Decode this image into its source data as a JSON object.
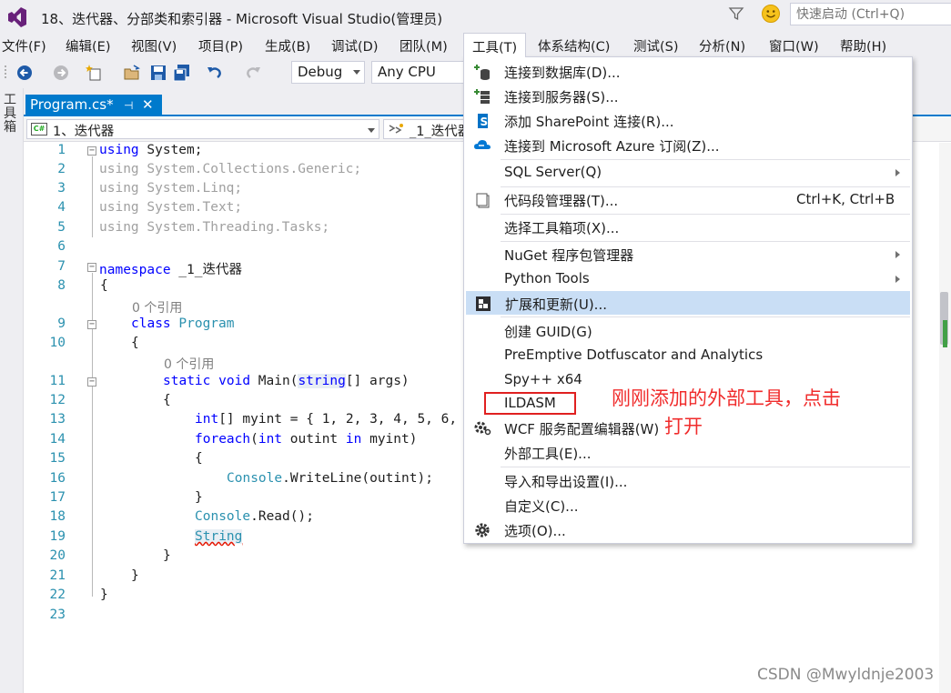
{
  "window": {
    "title": "18、迭代器、分部类和索引器 - Microsoft Visual Studio(管理员)",
    "quick_launch_placeholder": "快速启动 (Ctrl+Q)"
  },
  "menubar": {
    "items": [
      "文件(F)",
      "编辑(E)",
      "视图(V)",
      "项目(P)",
      "生成(B)",
      "调试(D)",
      "团队(M)",
      "工具(T)",
      "体系结构(C)",
      "测试(S)",
      "分析(N)",
      "窗口(W)",
      "帮助(H)"
    ],
    "open_item": "工具(T)"
  },
  "toolbar": {
    "config": "Debug",
    "platform": "Any CPU"
  },
  "toolbox_label": "工具箱",
  "tab": {
    "title": "Program.cs*",
    "pin_glyph": "⊣",
    "close_glyph": "✕"
  },
  "navbar": {
    "left": "1、迭代器",
    "right": "_1_迭代器"
  },
  "editor": {
    "line_numbers": [
      "1",
      "2",
      "3",
      "4",
      "5",
      "6",
      "7",
      "8",
      "9",
      "10",
      "11",
      "12",
      "13",
      "14",
      "15",
      "16",
      "17",
      "18",
      "19",
      "20",
      "21",
      "22",
      "23"
    ],
    "lines": {
      "l1_using": "using",
      "l1_rest": " System;",
      "l2": "using System.Collections.Generic;",
      "l3": "using System.Linq;",
      "l4": "using System.Text;",
      "l5": "using System.Threading.Tasks;",
      "l7_kw": "namespace",
      "l7_rest": " _1_迭代器",
      "l8": "{",
      "ref1": "0 个引用",
      "l9_kw": "class",
      "l9_type": "Program",
      "l10": "{",
      "ref2": "0 个引用",
      "l11_kw1": "static",
      "l11_kw2": "void",
      "l11_name": "Main(",
      "l11_type": "string",
      "l11_rest": "[] args)",
      "l12": "{",
      "l13_kw": "int",
      "l13_rest": "[] myint = { 1, 2, 3, 4, 5, 6,",
      "l14_kw": "foreach",
      "l14_p": "(",
      "l14_kw2": "int",
      "l14_mid": " outint ",
      "l14_kw3": "in",
      "l14_rest": " myint)",
      "l15": "{",
      "l16_type": "Console",
      "l16_rest": ".WriteLine(outint);",
      "l17": "}",
      "l18_type": "Console",
      "l18_rest": ".Read();",
      "l19_type": "String",
      "l20": "}",
      "l21": "}",
      "l22": "}"
    }
  },
  "tools_menu": {
    "items": [
      {
        "label": "连接到数据库(D)...",
        "icon": "database-plus-icon"
      },
      {
        "label": "连接到服务器(S)...",
        "icon": "server-plus-icon"
      },
      {
        "label": "添加 SharePoint 连接(R)...",
        "icon": "sharepoint-icon"
      },
      {
        "label": "连接到 Microsoft Azure 订阅(Z)...",
        "icon": "azure-cloud-icon"
      },
      {
        "label": "SQL Server(Q)",
        "submenu": true
      },
      {
        "label": "代码段管理器(T)...",
        "shortcut": "Ctrl+K, Ctrl+B",
        "icon": "snippet-icon"
      },
      {
        "label": "选择工具箱项(X)..."
      },
      {
        "label": "NuGet 程序包管理器",
        "submenu": true
      },
      {
        "label": "Python Tools",
        "submenu": true
      },
      {
        "label": "扩展和更新(U)...",
        "icon": "extensions-icon",
        "highlighted": true
      },
      {
        "label": "创建 GUID(G)"
      },
      {
        "label": "PreEmptive Dotfuscator and Analytics"
      },
      {
        "label": "Spy++ x64"
      },
      {
        "label": "ILDASM"
      },
      {
        "label": "WCF 服务配置编辑器(W)",
        "icon": "wcf-gear-icon"
      },
      {
        "label": "外部工具(E)..."
      },
      {
        "label": "导入和导出设置(I)..."
      },
      {
        "label": "自定义(C)..."
      },
      {
        "label": "选项(O)...",
        "icon": "options-gear-icon"
      }
    ]
  },
  "annotation": {
    "line1": "刚刚添加的外部工具，点击",
    "line2": "打开",
    "color": "#f02c2c"
  },
  "watermark": "CSDN @Mwyldnje2003",
  "colors": {
    "accent": "#007acc",
    "chrome": "#eeeef2",
    "menu_highlight": "#c9def5",
    "keyword": "#0000ff",
    "type": "#2b91af"
  }
}
